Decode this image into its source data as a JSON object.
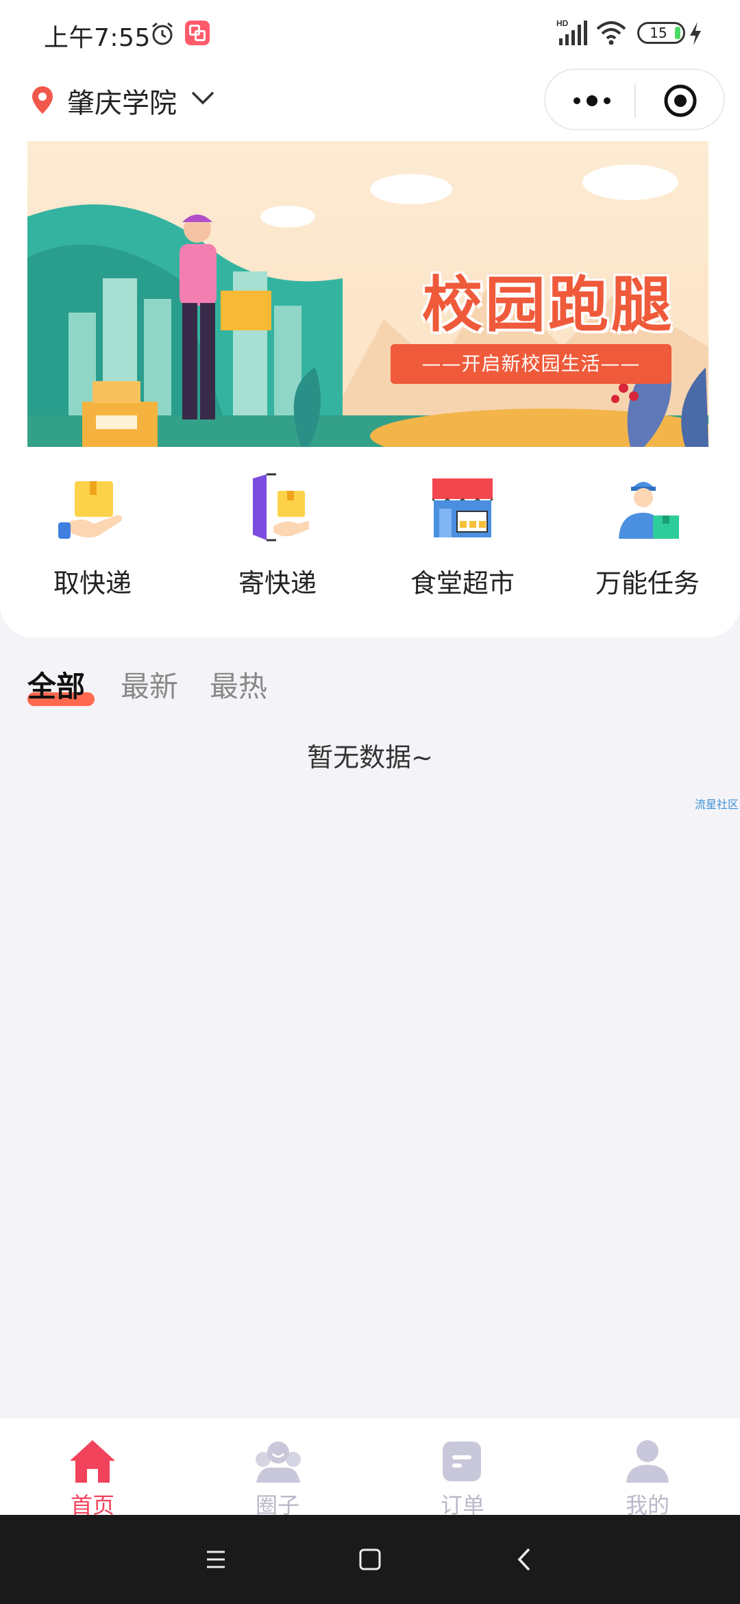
{
  "status_bar": {
    "time": "上午7:55",
    "battery": "15",
    "network": "HD"
  },
  "header": {
    "location": "肇庆学院"
  },
  "banner": {
    "title": "校园跑腿",
    "subtitle": "——开启新校园生活——"
  },
  "services": [
    {
      "label": "取快递",
      "icon": "package-pickup-icon"
    },
    {
      "label": "寄快递",
      "icon": "package-send-icon"
    },
    {
      "label": "食堂超市",
      "icon": "store-icon"
    },
    {
      "label": "万能任务",
      "icon": "courier-icon"
    }
  ],
  "feed_tabs": [
    {
      "label": "全部",
      "active": true
    },
    {
      "label": "最新",
      "active": false
    },
    {
      "label": "最热",
      "active": false
    }
  ],
  "feed": {
    "empty_text": "暂无数据~",
    "watermark": "流星社区"
  },
  "tabbar": [
    {
      "label": "首页",
      "icon": "home-icon",
      "active": true
    },
    {
      "label": "圈子",
      "icon": "community-icon",
      "active": false
    },
    {
      "label": "订单",
      "icon": "order-icon",
      "active": false
    },
    {
      "label": "我的",
      "icon": "profile-icon",
      "active": false
    }
  ],
  "colors": {
    "accent": "#f2435c",
    "banner_red": "#ef5a3a",
    "tab_inactive": "#b8b8c8",
    "page_bg": "#f4f4f8"
  }
}
